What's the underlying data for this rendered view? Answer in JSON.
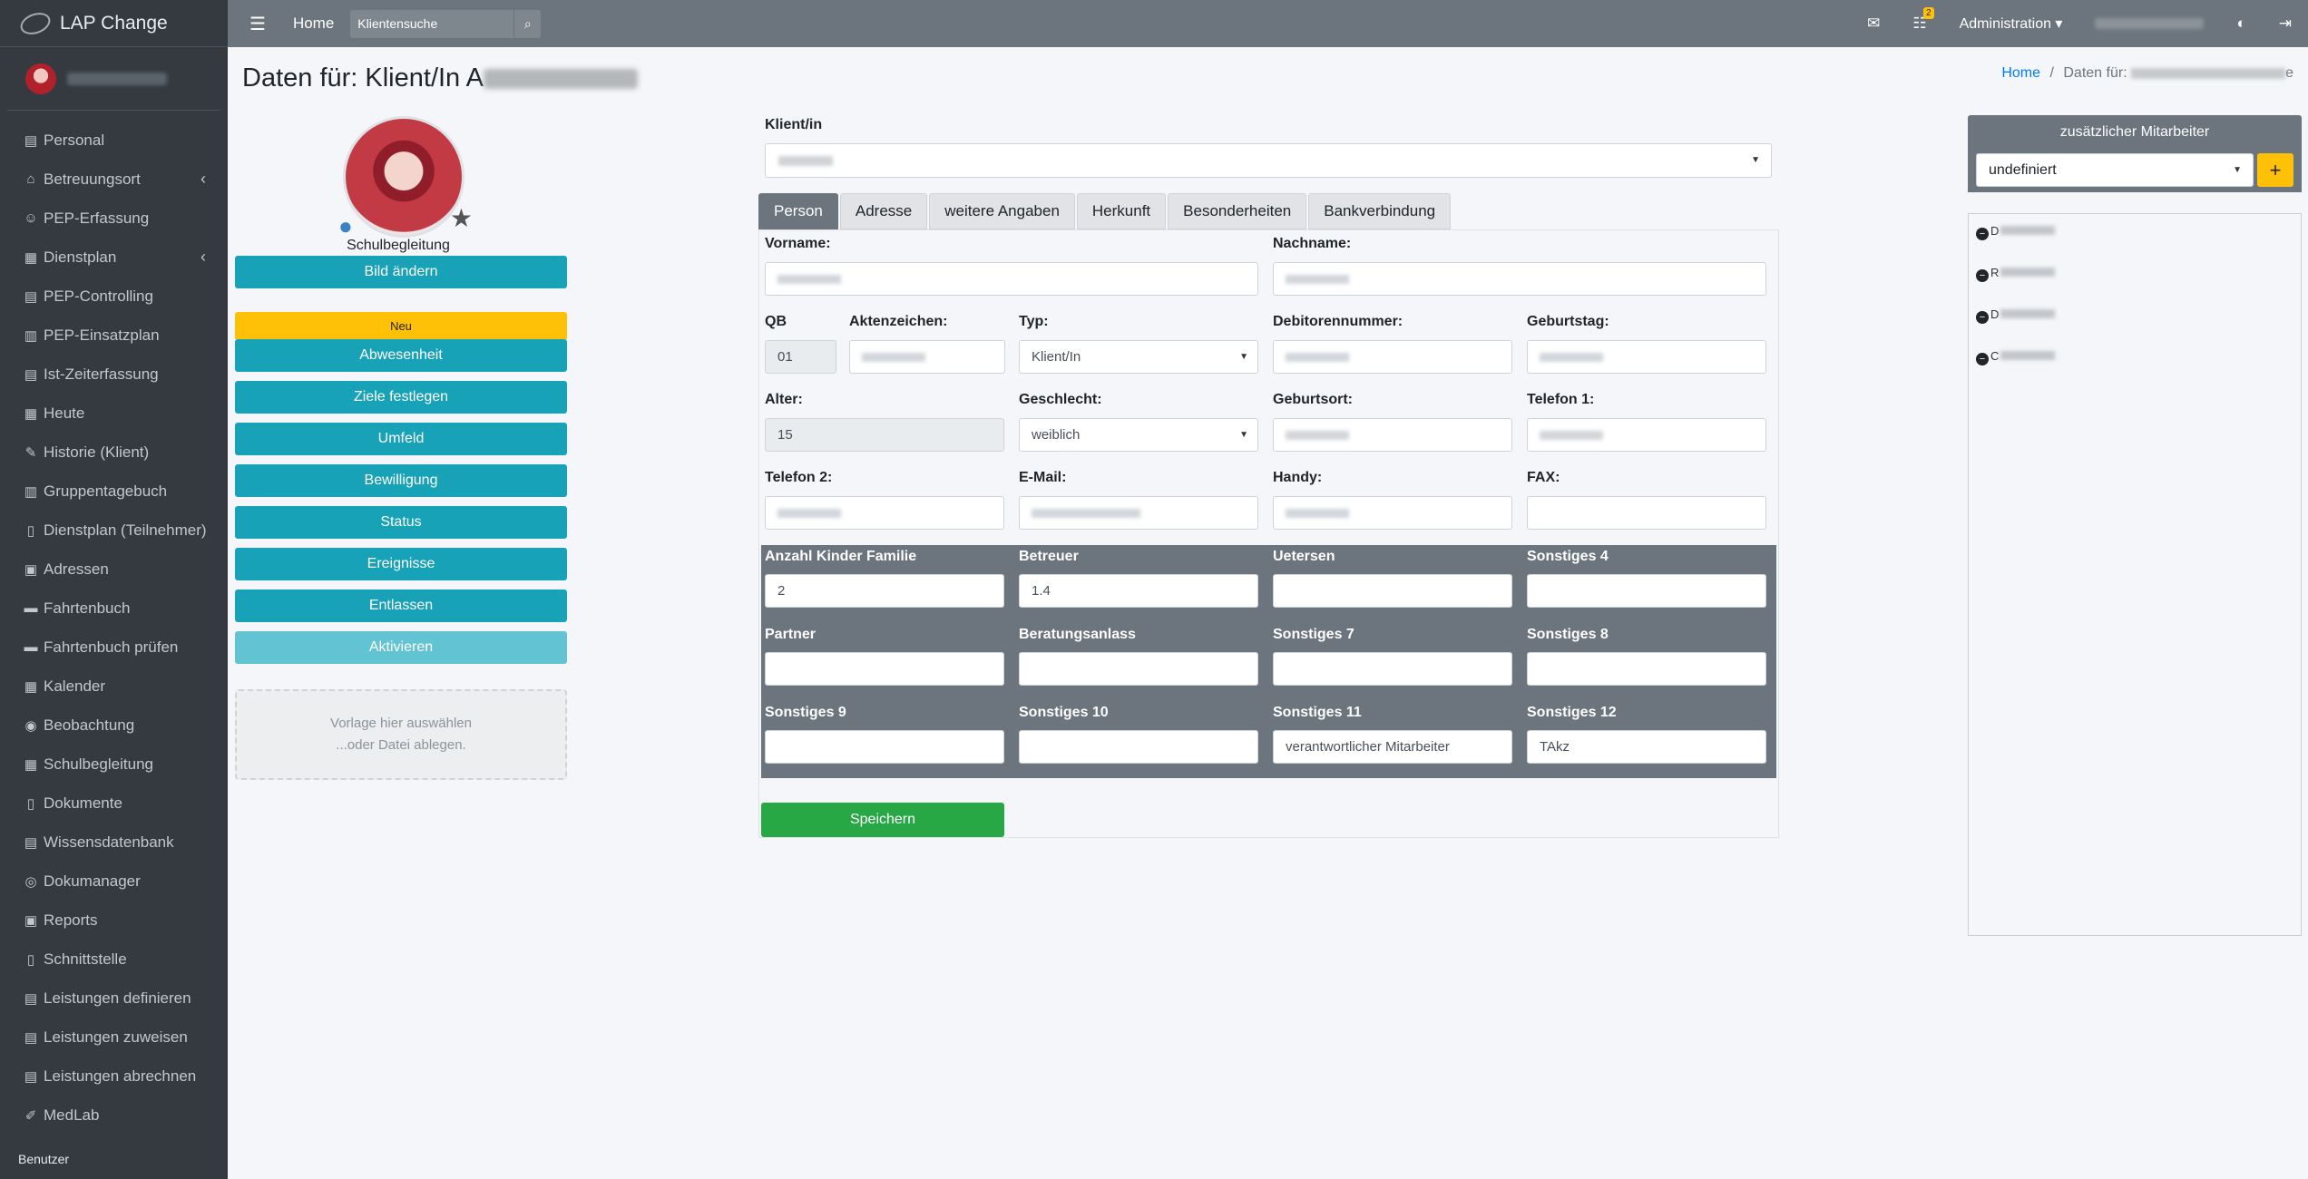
{
  "app": {
    "title": "LAP Change"
  },
  "sidebar": {
    "items": [
      {
        "label": "Personal",
        "icon": "id-card-icon",
        "glyph": "▤"
      },
      {
        "label": "Betreuungsort",
        "icon": "home-icon",
        "glyph": "⌂",
        "caret": "‹"
      },
      {
        "label": "PEP-Erfassung",
        "icon": "user-clock-icon",
        "glyph": "☺"
      },
      {
        "label": "Dienstplan",
        "icon": "table-icon",
        "glyph": "▦",
        "caret": "‹"
      },
      {
        "label": "PEP-Controlling",
        "icon": "id-card-icon",
        "glyph": "▤"
      },
      {
        "label": "PEP-Einsatzplan",
        "icon": "map-icon",
        "glyph": "▥"
      },
      {
        "label": "Ist-Zeiterfassung",
        "icon": "list-icon",
        "glyph": "▤"
      },
      {
        "label": "Heute",
        "icon": "calendar-icon",
        "glyph": "▦"
      },
      {
        "label": "Historie (Klient)",
        "icon": "edit-icon",
        "glyph": "✎"
      },
      {
        "label": "Gruppentagebuch",
        "icon": "book-icon",
        "glyph": "▥"
      },
      {
        "label": "Dienstplan (Teilnehmer)",
        "icon": "file-icon",
        "glyph": "▯"
      },
      {
        "label": "Adressen",
        "icon": "address-book-icon",
        "glyph": "▣"
      },
      {
        "label": "Fahrtenbuch",
        "icon": "car-icon",
        "glyph": "▬"
      },
      {
        "label": "Fahrtenbuch prüfen",
        "icon": "car-icon",
        "glyph": "▬"
      },
      {
        "label": "Kalender",
        "icon": "calendar-icon",
        "glyph": "▦"
      },
      {
        "label": "Beobachtung",
        "icon": "eye-icon",
        "glyph": "◉"
      },
      {
        "label": "Schulbegleitung",
        "icon": "calendar-icon",
        "glyph": "▦"
      },
      {
        "label": "Dokumente",
        "icon": "file-icon",
        "glyph": "▯"
      },
      {
        "label": "Wissensdatenbank",
        "icon": "briefcase-icon",
        "glyph": "▤"
      },
      {
        "label": "Dokumanager",
        "icon": "database-icon",
        "glyph": "◎"
      },
      {
        "label": "Reports",
        "icon": "clipboard-icon",
        "glyph": "▣"
      },
      {
        "label": "Schnittstelle",
        "icon": "file-export-icon",
        "glyph": "▯"
      },
      {
        "label": "Leistungen definieren",
        "icon": "id-card-icon",
        "glyph": "▤"
      },
      {
        "label": "Leistungen zuweisen",
        "icon": "id-card-icon",
        "glyph": "▤"
      },
      {
        "label": "Leistungen abrechnen",
        "icon": "id-card-icon",
        "glyph": "▤"
      },
      {
        "label": "MedLab",
        "icon": "syringe-icon",
        "glyph": "✐"
      }
    ],
    "footer": "Benutzer"
  },
  "topbar": {
    "home": "Home",
    "search_placeholder": "Klientensuche",
    "notification_count": "2",
    "admin": "Administration ▾"
  },
  "page": {
    "title_prefix": "Daten für: Klient/In A",
    "breadcrumb_home": "Home",
    "breadcrumb_sep": "/",
    "breadcrumb_current": "Daten für:",
    "breadcrumb_tail": "e"
  },
  "left": {
    "role": "Schulbegleitung",
    "change_picture": "Bild ändern",
    "new_badge": "Neu",
    "buttons": [
      "Abwesenheit",
      "Ziele festlegen",
      "Umfeld",
      "Bewilligung",
      "Status",
      "Ereignisse",
      "Entlassen"
    ],
    "activate": "Aktivieren",
    "dropzone_line1": "Vorlage hier auswählen",
    "dropzone_line2": "...oder Datei ablegen."
  },
  "client": {
    "label": "Klient/in"
  },
  "tabs": [
    "Person",
    "Adresse",
    "weitere Angaben",
    "Herkunft",
    "Besonderheiten",
    "Bankverbindung"
  ],
  "form": {
    "vorname": "Vorname:",
    "nachname": "Nachname:",
    "qb": "QB",
    "qb_value": "01",
    "aktenzeichen": "Aktenzeichen:",
    "typ": "Typ:",
    "typ_value": "Klient/In",
    "debitorennummer": "Debitorennummer:",
    "geburtstag": "Geburtstag:",
    "alter": "Alter:",
    "alter_value": "15",
    "geschlecht": "Geschlecht:",
    "geschlecht_value": "weiblich",
    "geburtsort": "Geburtsort:",
    "telefon1": "Telefon 1:",
    "telefon2": "Telefon 2:",
    "email": "E-Mail:",
    "handy": "Handy:",
    "fax": "FAX:",
    "extra": {
      "anzahl_kinder": "Anzahl Kinder Familie",
      "anzahl_kinder_value": "2",
      "betreuer": "Betreuer",
      "betreuer_value": "1.4",
      "uetersen": "Uetersen",
      "sonstiges4": "Sonstiges 4",
      "partner": "Partner",
      "beratungsanlass": "Beratungsanlass",
      "sonstiges7": "Sonstiges 7",
      "sonstiges8": "Sonstiges 8",
      "sonstiges9": "Sonstiges 9",
      "sonstiges10": "Sonstiges 10",
      "sonstiges11": "Sonstiges 11",
      "sonstiges11_value": "verantwortlicher Mitarbeiter",
      "sonstiges12": "Sonstiges 12",
      "sonstiges12_value": "TAkz"
    },
    "save": "Speichern"
  },
  "right_panel": {
    "title": "zusätzlicher Mitarbeiter",
    "select_value": "undefiniert",
    "add": "+",
    "items": [
      "D",
      "R",
      "D",
      "C"
    ]
  },
  "colors": {
    "sidebar": "#343a40",
    "topbar": "#6c757d",
    "info": "#17a2b8",
    "warning": "#ffc107",
    "success": "#28a745"
  }
}
